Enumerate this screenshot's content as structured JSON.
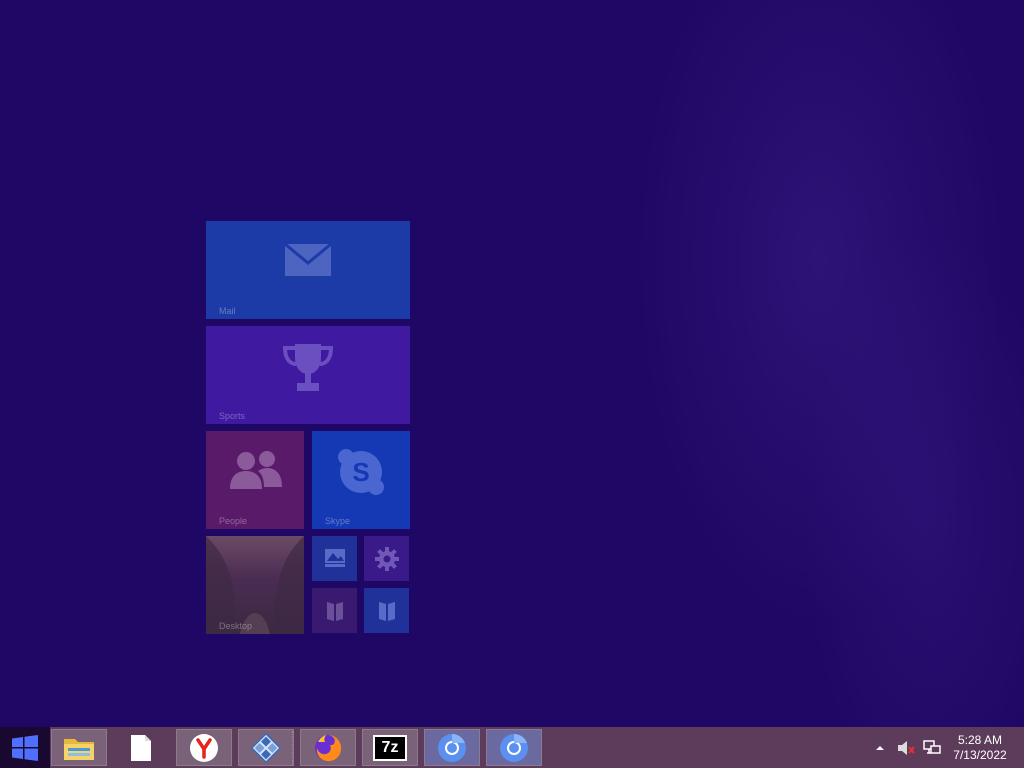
{
  "start_screen": {
    "tiles": [
      {
        "id": "mail",
        "label": "Mail",
        "color": "#1d3ba6"
      },
      {
        "id": "sports",
        "label": "Sports",
        "color": "#3f1aa0"
      },
      {
        "id": "people",
        "label": "People",
        "color": "#5a1a6a"
      },
      {
        "id": "skype",
        "label": "Skype",
        "color": "#1538b4"
      },
      {
        "id": "desktop",
        "label": "Desktop",
        "color": "#4a2c52"
      },
      {
        "id": "store-small",
        "label": "",
        "color": "#20329a"
      },
      {
        "id": "settings-small",
        "label": "",
        "color": "#3a1a88"
      },
      {
        "id": "reader-small",
        "label": "",
        "color": "#3a1a70"
      },
      {
        "id": "reader2-small",
        "label": "",
        "color": "#20329a"
      }
    ]
  },
  "taskbar": {
    "start_icon": "windows-logo-icon",
    "pinned": [
      {
        "name": "file-explorer",
        "icon": "folder-icon"
      },
      {
        "name": "blank-document",
        "icon": "document-icon"
      },
      {
        "name": "yandex-browser",
        "icon": "yandex-icon"
      },
      {
        "name": "network-app",
        "icon": "diamond-grid-icon"
      },
      {
        "name": "firefox",
        "icon": "firefox-icon"
      },
      {
        "name": "7zip",
        "icon": "7zip-icon",
        "text": "7z"
      },
      {
        "name": "chromium-1",
        "icon": "chromium-icon"
      },
      {
        "name": "chromium-2",
        "icon": "chromium-icon"
      }
    ],
    "tray": {
      "overflow_icon": "chevron-up-icon",
      "volume_icon": "volume-muted-icon",
      "network_icon": "network-icon"
    },
    "clock": {
      "time": "5:28 AM",
      "date": "7/13/2022"
    }
  }
}
